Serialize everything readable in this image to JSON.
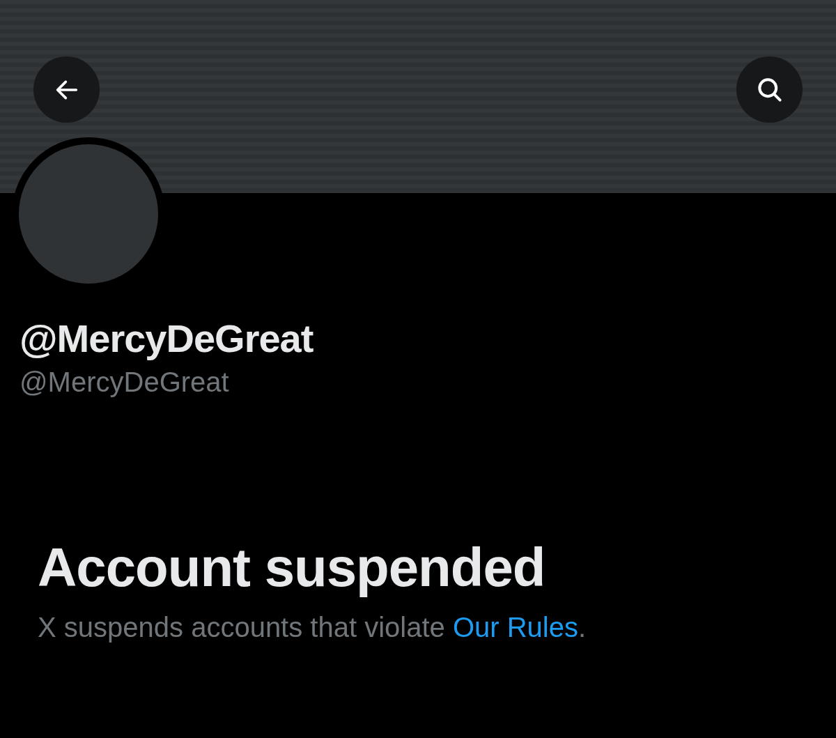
{
  "header": {
    "buttons": [
      {
        "kind": "back"
      },
      {
        "kind": "search"
      }
    ]
  },
  "profile": {
    "display_name": "@MercyDeGreat",
    "handle": "@MercyDeGreat"
  },
  "notice": {
    "title": "Account suspended",
    "text": "X suspends accounts that violate ",
    "link": "Our Rules",
    "end": "."
  }
}
